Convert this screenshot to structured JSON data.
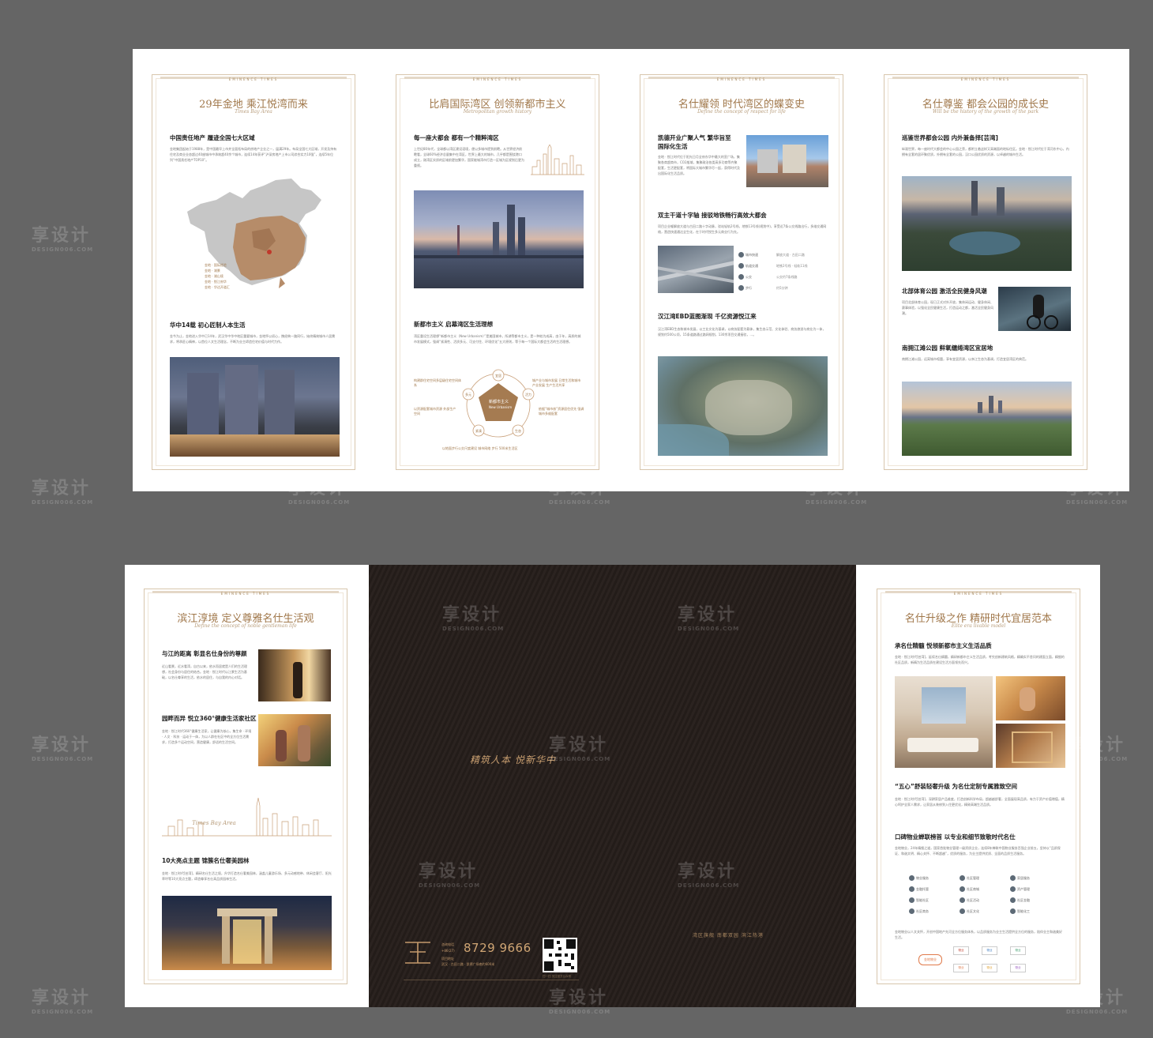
{
  "top_panels": [
    {
      "title": "29年金地 乘江悦湾而来",
      "subtitle": "Times Bay Area",
      "s1": "中国责任地产 履迹全国七大区域",
      "s1_text": "金地集团起始于1988年，是中国最早上市并全面拓布局的房地产企业之一，届满29年。布局全国七大区域，开发及持有住宅及商业业态超过40座城市中承筑超40余个城市，连续14年获评“沪深房地产上市公司综合实力10强”，连续5年位列“中国责任地产TOP10”。",
      "map_labels": [
        "金地 · 国际经验",
        "金地 · 湖景",
        "金地 · 湖山境",
        "金地 · 悦江府华",
        "金地 · 华达开道汇"
      ],
      "s2": "华中14载 初心匠制人本生活",
      "s2_text": "金今为止，金地进入华中已14年，武汉华中华中地区重要城市，金地怀以初心，携经典一路同行，始终精筑城市人居需求，将承匠心精神，以首位人文生活理念，不断为业主缔造住宅价值与时代力作。"
    },
    {
      "title": "比肩国际湾区 创领新都市主义",
      "subtitle": "Metropolitan growth history",
      "s1": "每一座大都会 都有一个精粹湾区",
      "s1_text": "上世纪80年代，全球都以湾区建设语境，便以多城市提到前瞻。从世界经济前瞻看，全球60%经济总量集中在湾区，世界上最大的城市，几乎都是围绕港口成立，刚湾区实质的区域前更加繁华，国家能城湾市打造一区城为区规划后更为重视。",
      "s2": "新都市主义 启幕湾区生活理想",
      "s2_text": "湾区重设生活理想“新都市主义（New Urbanism）”是美国城市，所湖等都市主义，是一种较为成高，由于年，高质的城市发展模式，强调“紧凑性、活质多元、可支付住、环境优化”五大原则，等于每一个国际大都会生活的生活理想。",
      "diagram_center": "新都市主义",
      "diagram_center_en": "New Urbanism",
      "diagram_nodes": [
        "宜居",
        "活力",
        "生态",
        "紧凑",
        "多元"
      ],
      "diagram_notes": [
        "构建群住宅空间多层级住宅空间体系",
        "城产业与城市发展 日常生活和城市产业发展 生产生活共享",
        "依据“城市核”资源居住优先 强调城市多维配套",
        "以资源配套城市资源 外部生产空间",
        "人行空间是商务",
        "以地面步行公交尺度建设 城市网络 步行 500米生活区"
      ]
    },
    {
      "title": "名仕耀领 时代湾区的蝶变史",
      "subtitle": "Define the concept of respect for life",
      "s1": "凯德开业广聚人气 繁华旨至国际化生活",
      "s1_text": "金地 · 悦江时代位于阳光日月全府东华中最大的宣广场，集聚各商超商市，CO2般域，集聚政治各类高多功商等齐聚配套，生活更配套，将国际大城市繁华尽一起，获得时代及出国际化生活品质。",
      "s2": "双主干道十字轴 接驳地铁畅行高效大都会",
      "s2_text": "项目企业躯解放大道与古田二路十字动脉，驳站轻轨2号线，地铁13号线(规划中)，享受近7条公交线路出行，多维交通网络，营造快速通达全生化，在于时代悦生多元商业行为先。",
      "transport": [
        {
          "name": "城市快速",
          "desc": "解放大道 · 古田二路"
        },
        {
          "name": "轨道交通",
          "desc": "地铁2号线 · 轻轨11线"
        },
        {
          "name": "公交",
          "desc": "公交约7条线路"
        },
        {
          "name": "步行",
          "desc": "约5分钟"
        }
      ],
      "s3": "汉江湾EBD蓝图渐现 千亿资源悦江来",
      "s3_text": "汉江湾EBD生态和城市发展，以工业文化为基调，以商务配套为载体，集生态示范、文化体验、商务旅游与商业为一体，规划约500公顷，15条道路通过路网规划，130余项目交通接驳，…。"
    },
    {
      "title": "名仕尊鉴 都会公园的成长史",
      "subtitle": "Will be the history of the growth of the park",
      "s1": "巡鉴世界都会公园 内外兼备择[芸湾]",
      "s1_text": "纵观世界，每一座时代大都会的中心公园之旁，都附立着这样又高端面的地标住区。金地 · 悦江时代位于湾河东中心，内拥有全套的居环聚优质，外拥有全套的公园，汉口公园优质的资源，以卓越的城市生活。",
      "s2": "北部体育公园 激活全民健身风潮",
      "s2_text": "项目北部体育公园，现已正式对外开放，集休闲运动、健身休闲、赛事体验，以强化全民健康生活，打造运动之都，激活全民健身风潮。",
      "s3": "南拥江滩公园 鲜氧缱绻湾区宜居地",
      "s3_text": "南拥江滩公园，远离城市喧嚣，享有宜居资源，以亲江生态为基调，打造宜居湾区的典范。"
    }
  ],
  "bottom_left": {
    "title": "滨江淳境 定义尊雅名仕生活观",
    "subtitle": "Define the concept of noble gentleman life",
    "s1": "与江的距离 彰显名仕身份的尊颜",
    "s1_text": "近山看景，近水看湾，自古以来，依水而居就是人们的生活理想，社会身份与居住的结合。金地 · 悦江时代以江景生活为基础，以名仕尊享的生活，依水的居住，与自我的内心对话。",
    "s2": "园畔而异 悦立360°健康生活家社区",
    "s2_text": "金地 · 悦江时代360°健康生活家，让健康为核心，集生命 · 环境 · 人文 · 科技 · 运动于一体，为以人群在社区中的全方位生活需求，打造多个运动空间，营造健康，舒适的生活空间。",
    "sketch_text": "Times Bay Area",
    "s3": "10大亮点主题 锦簇名仕奢美园林",
    "s3_text": "金地 · 悦江时代[芸湾]，精研名仕生活之境，升华打造名仕奢美园林，涵盖儿童游乐场、多元动感地带、休闲会客厅、阳光草坪等10大亮点主题，缔造尊享名仕高品质园林生活。"
  },
  "cover": {
    "brand": "精筑人本 悦新华中",
    "tagline": "湾区旗舰  南都双园  滨江热港",
    "hotline_label": "咨询电话",
    "area_code": "+86(27)",
    "phone": "8729 9666",
    "address_label": "项目地址",
    "address": "武汉 · 古田二路 · 凯德广场南约600米",
    "qr_caption": "扫一扫 关注官方公众号"
  },
  "bottom_right": {
    "title": "名仕升级之作 精研时代宜居范本",
    "subtitle": "Elite era livable model",
    "s1": "承名仕精髓 悦领新都市主义生活品质",
    "s1_text": "金地 · 悦江时代[芸湾]，延续名仕精髓，精研新都市主义生活品质，考究创新建筑风格，精确实不舍问的建面立面，精细的社区品质，新精为生活品质在建设生活方面领先而兴。",
    "s2": "“五心”舒装轻奢升级 为名仕定制专属雅致空间",
    "s2_text": "金地 · 悦江时代[芸湾]，深耕家居产品维度，打造创新科学布局，超越越舒奢，全面展现高品质，有力于资产价值增值，精心呵护全家人需求，让家居从装修到入住更优化，精致高端生活品质。",
    "s3": "口碑物业蝉联榜首 以专业和细节致敬时代名仕",
    "s3_text": "金地物业，24年精细之道，国家首批物业管理一级资质企业，连续8年蝉联中国物业服务百强企业前五，坚持以“品质保证、和谐文明、精心关怀、不断超越”，优质的服务，为业主提供优质、全面的品质生活服务。",
    "services": [
      "物业服务",
      "社区管理",
      "家居服务",
      "金融托管",
      "社区商城",
      "资产管理",
      "智能社区",
      "社区活动",
      "社区金融",
      "社区商务",
      "社区文化",
      "智能化工"
    ],
    "s4_text": "金地物业以人文关怀，开创中国地产先河全方位服务体系，以品质服务为业主生活提供全方位的服务，陪伴业主和谐美好生活。",
    "logos": [
      "金地物业",
      "物业",
      "物业",
      "物业",
      "物业",
      "物业",
      "物业",
      "物业",
      "物业",
      "物业"
    ]
  },
  "watermark": {
    "main": "享设计",
    "sub": "DESIGN006.COM"
  }
}
